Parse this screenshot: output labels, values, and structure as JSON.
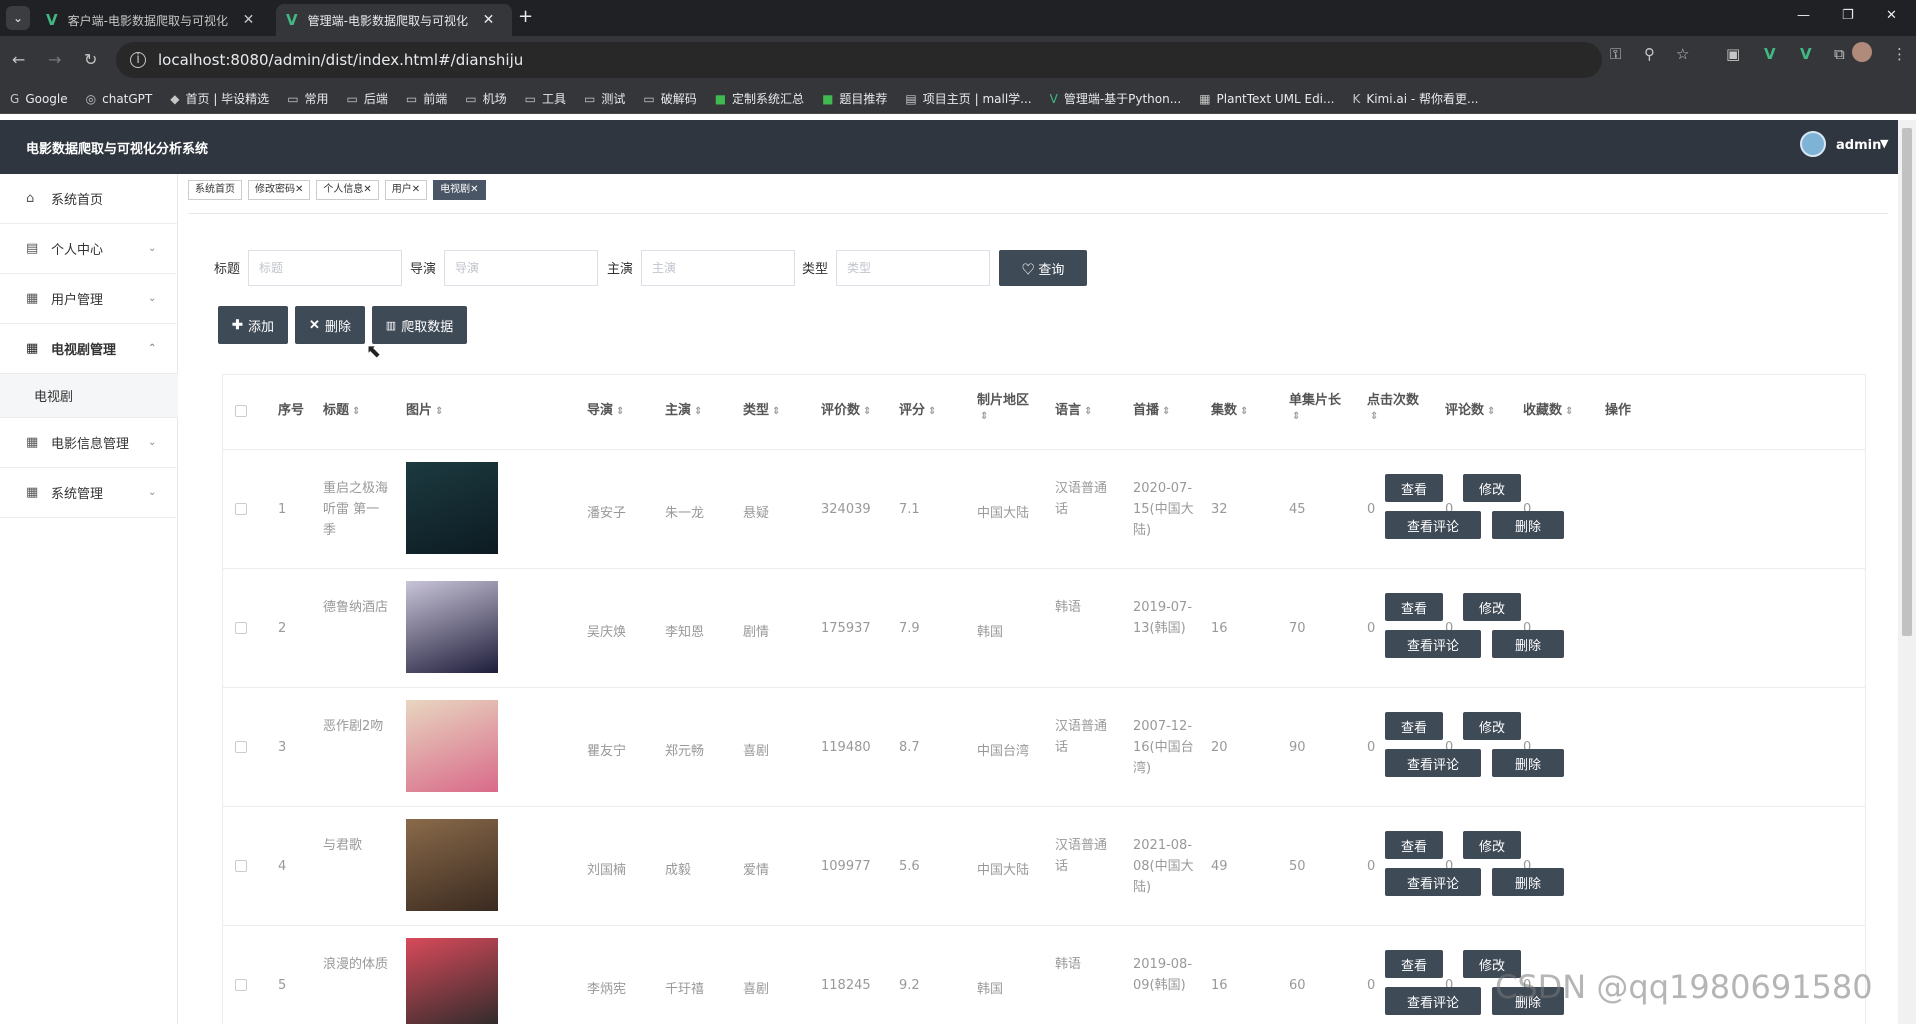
{
  "browser": {
    "tabs": [
      {
        "title": "客户端-电影数据爬取与可视化",
        "active": false
      },
      {
        "title": "管理端-电影数据爬取与可视化",
        "active": true
      }
    ],
    "url": "localhost:8080/admin/dist/index.html#/dianshiju",
    "bookmarks": [
      "Google",
      "chatGPT",
      "首页 | 毕设精选",
      "常用",
      "后端",
      "前端",
      "机场",
      "工具",
      "测试",
      "破解码",
      "定制系统汇总",
      "题目推荐",
      "项目主页 | mall学...",
      "管理端-基于Python...",
      "PlantText UML Edi...",
      "Kimi.ai - 帮你看更..."
    ]
  },
  "header": {
    "title": "电影数据爬取与可视化分析系统",
    "user": "admin"
  },
  "sidebar": {
    "items": [
      {
        "label": "系统首页",
        "icon": "home-icon"
      },
      {
        "label": "个人中心",
        "icon": "card-icon"
      },
      {
        "label": "用户管理",
        "icon": "grid-icon"
      },
      {
        "label": "电视剧管理",
        "icon": "grid-icon"
      },
      {
        "label": "电视剧",
        "icon": ""
      },
      {
        "label": "电影信息管理",
        "icon": "grid-icon"
      },
      {
        "label": "系统管理",
        "icon": "grid-icon"
      }
    ]
  },
  "tags": [
    "系统首页",
    "修改密码",
    "个人信息",
    "用户",
    "电视剧"
  ],
  "search": {
    "title_label": "标题",
    "title_placeholder": "标题",
    "director_label": "导演",
    "director_placeholder": "导演",
    "actor_label": "主演",
    "actor_placeholder": "主演",
    "type_label": "类型",
    "type_placeholder": "类型",
    "query_button": "查询"
  },
  "actions": {
    "add": "添加",
    "delete": "删除",
    "crawl": "爬取数据"
  },
  "table": {
    "headers": [
      "序号",
      "标题",
      "图片",
      "导演",
      "主演",
      "类型",
      "评价数",
      "评分",
      "制片地区",
      "语言",
      "首播",
      "集数",
      "单集片长",
      "点击次数",
      "评论数",
      "收藏数",
      "操作"
    ],
    "row_buttons": {
      "view": "查看",
      "edit": "修改",
      "comments": "查看评论",
      "delete": "删除"
    },
    "rows": [
      {
        "no": "1",
        "title": "重启之极海听雷 第一季",
        "director": "潘安子",
        "actor": "朱一龙",
        "type": "悬疑",
        "ratings": "324039",
        "score": "7.1",
        "region": "中国大陆",
        "language": "汉语普通话",
        "premiere": "2020-07-15(中国大陆)",
        "episodes": "32",
        "length": "45",
        "clicks": "0",
        "comments": "0",
        "favorites": "0",
        "poster_colors": [
          "#1c3a40",
          "#0d1b22"
        ]
      },
      {
        "no": "2",
        "title": "德鲁纳酒店",
        "director": "吴庆焕",
        "actor": "李知恩",
        "type": "剧情",
        "ratings": "175937",
        "score": "7.9",
        "region": "韩国",
        "language": "韩语",
        "premiere": "2019-07-13(韩国)",
        "episodes": "16",
        "length": "70",
        "clicks": "0",
        "comments": "0",
        "favorites": "0",
        "poster_colors": [
          "#c9c4d8",
          "#1e1d3a"
        ]
      },
      {
        "no": "3",
        "title": "恶作剧2吻",
        "director": "瞿友宁",
        "actor": "郑元畅",
        "type": "喜剧",
        "ratings": "119480",
        "score": "8.7",
        "region": "中国台湾",
        "language": "汉语普通话",
        "premiere": "2007-12-16(中国台湾)",
        "episodes": "20",
        "length": "90",
        "clicks": "0",
        "comments": "0",
        "favorites": "0",
        "poster_colors": [
          "#e8d6c0",
          "#d96a8a"
        ]
      },
      {
        "no": "4",
        "title": "与君歌",
        "director": "刘国楠",
        "actor": "成毅",
        "type": "爱情",
        "ratings": "109977",
        "score": "5.6",
        "region": "中国大陆",
        "language": "汉语普通话",
        "premiere": "2021-08-08(中国大陆)",
        "episodes": "49",
        "length": "50",
        "clicks": "0",
        "comments": "0",
        "favorites": "0",
        "poster_colors": [
          "#8a6a4a",
          "#3a2a20"
        ]
      },
      {
        "no": "5",
        "title": "浪漫的体质",
        "director": "李炳宪",
        "actor": "千玗禧",
        "type": "喜剧",
        "ratings": "118245",
        "score": "9.2",
        "region": "韩国",
        "language": "韩语",
        "premiere": "2019-08-09(韩国)",
        "episodes": "16",
        "length": "60",
        "clicks": "0",
        "comments": "0",
        "favorites": "0",
        "poster_colors": [
          "#d84a5a",
          "#2a2a2a"
        ]
      }
    ]
  },
  "watermark": "CSDN @qq1980691580",
  "colors": {
    "header_bg": "#2f3640",
    "button_bg": "#3f4a57",
    "tag_active": "#4a5565"
  }
}
